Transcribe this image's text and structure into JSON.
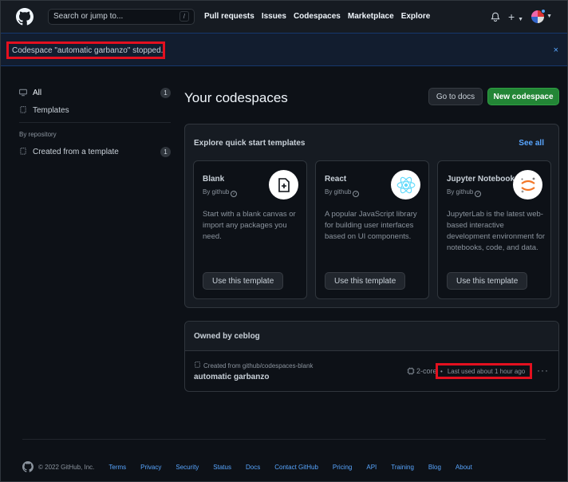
{
  "header": {
    "search_placeholder": "Search or jump to...",
    "search_shortcut": "/",
    "nav": [
      "Pull requests",
      "Issues",
      "Codespaces",
      "Marketplace",
      "Explore"
    ],
    "plus": "+"
  },
  "flash": {
    "message": "Codespace \"automatic garbanzo\" stopped.",
    "close": "×"
  },
  "sidebar": {
    "items": [
      {
        "label": "All",
        "count": "1"
      },
      {
        "label": "Templates"
      }
    ],
    "group_heading": "By repository",
    "group_items": [
      {
        "label": "Created from a template",
        "count": "1"
      }
    ]
  },
  "main": {
    "title": "Your codespaces",
    "go_to_docs": "Go to docs",
    "new_codespace": "New codespace"
  },
  "templates": {
    "heading": "Explore quick start templates",
    "see_all": "See all",
    "cards": [
      {
        "name": "Blank",
        "by": "By github",
        "description": "Start with a blank canvas or import any packages you need.",
        "button": "Use this template"
      },
      {
        "name": "React",
        "by": "By github",
        "description": "A popular JavaScript library for building user interfaces based on UI components.",
        "button": "Use this template"
      },
      {
        "name": "Jupyter Notebook",
        "by": "By github",
        "description": "JupyterLab is the latest web-based interactive development environment for notebooks, code, and data.",
        "button": "Use this template"
      }
    ]
  },
  "owned": {
    "heading": "Owned by ceblog",
    "source": "Created from github/codespaces-blank",
    "name": "automatic garbanzo",
    "cores": "2-core",
    "last_used": "Last used about 1 hour ago",
    "more": "···"
  },
  "footer": {
    "copyright": "© 2022 GitHub, Inc.",
    "links": [
      "Terms",
      "Privacy",
      "Security",
      "Status",
      "Docs",
      "Contact GitHub",
      "Pricing",
      "API",
      "Training",
      "Blog",
      "About"
    ]
  },
  "colors": {
    "background": "#0d1117",
    "primary_button": "#238636",
    "link": "#58a6ff",
    "highlight_box": "#e3101f"
  }
}
